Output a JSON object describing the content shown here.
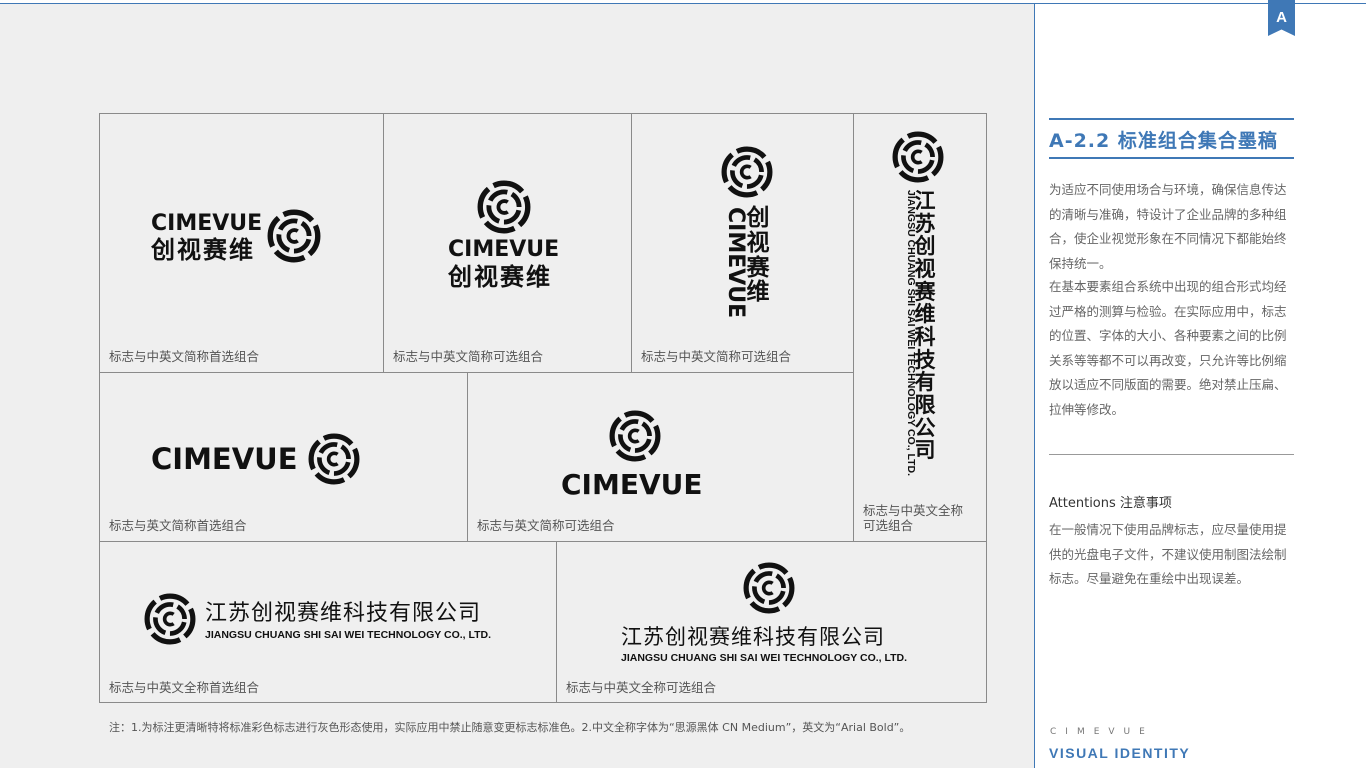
{
  "page_marker": "A",
  "section": {
    "title": "A-2.2  标准组合集合墨稿",
    "intro": "为适应不同使用场合与环境，确保信息传达的清晰与准确，特设计了企业品牌的多种组合，使企业视觉形象在不同情况下都能始终保持统一。",
    "detail": "在基本要素组合系统中出现的组合形式均经过严格的测算与检验。在实际应用中，标志的位置、字体的大小、各种要素之间的比例关系等等都不可以再改变，只允许等比例缩放以适应不同版面的需要。绝对禁止压扁、拉伸等修改。",
    "attention_title": "Attentions  注意事项",
    "attention_text": "在一般情况下使用品牌标志，应尽量使用提供的光盘电子文件，不建议使用制图法绘制标志。尽量避免在重绘中出现误差。"
  },
  "brand": {
    "wordmark": "CIMEVUE",
    "cn_short": "创视赛维",
    "cn_full": "江苏创视赛维科技有限公司",
    "en_full": "JIANGSU CHUANG SHI SAI WEI  TECHNOLOGY CO., LTD.",
    "emblem_icon": "cimevue-emblem-icon"
  },
  "captions": {
    "c1": "标志与中英文简称首选组合",
    "c2": "标志与中英文简称可选组合",
    "c3": "标志与中英文简称可选组合",
    "c4": "标志与中英文全称可选组合",
    "c5": "标志与英文简称首选组合",
    "c6": "标志与英文简称可选组合",
    "c7": "标志与中英文全称首选组合",
    "c8": "标志与中英文全称可选组合"
  },
  "footnote": "注：1.为标注更清晰特将标准彩色标志进行灰色形态使用，实际应用中禁止随意变更标志标准色。2.中文全称字体为“思源黑体 CN Medium”，英文为“Arial Bold”。",
  "footer": {
    "brand_spaced": "CIMEVUE",
    "system_label": "VISUAL IDENTITY"
  },
  "colors": {
    "accent": "#3f78b6",
    "panel": "#efefef",
    "ink": "#111111"
  }
}
